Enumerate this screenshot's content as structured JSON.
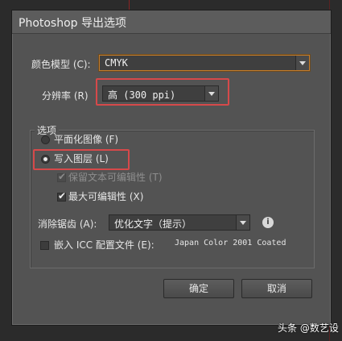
{
  "window": {
    "title": "Photoshop 导出选项"
  },
  "color_mode": {
    "label": "颜色模型 (C):",
    "value": "CMYK"
  },
  "resolution": {
    "label": "分辨率 (R)",
    "value": "高 (300 ppi)"
  },
  "options": {
    "group_title": "选项",
    "flatten_image": {
      "label": "平面化图像 (F)",
      "selected": false
    },
    "write_layers": {
      "label": "写入图层 (L)",
      "selected": true
    },
    "preserve_text_editability": {
      "label": "保留文本可编辑性 (T)",
      "checked": true,
      "enabled": false
    },
    "max_editability": {
      "label": "最大可编辑性 (X)",
      "checked": true
    },
    "anti_alias": {
      "label": "消除锯齿 (A):",
      "value": "优化文字（提示）"
    },
    "embed_icc": {
      "label": "嵌入 ICC 配置文件 (E):",
      "profile": "Japan Color 2001 Coated",
      "checked": false
    }
  },
  "buttons": {
    "ok": "确定",
    "cancel": "取消"
  },
  "watermark": "头条 @数艺设",
  "icons": {
    "info": "info-icon",
    "check": "checkmark-icon"
  }
}
